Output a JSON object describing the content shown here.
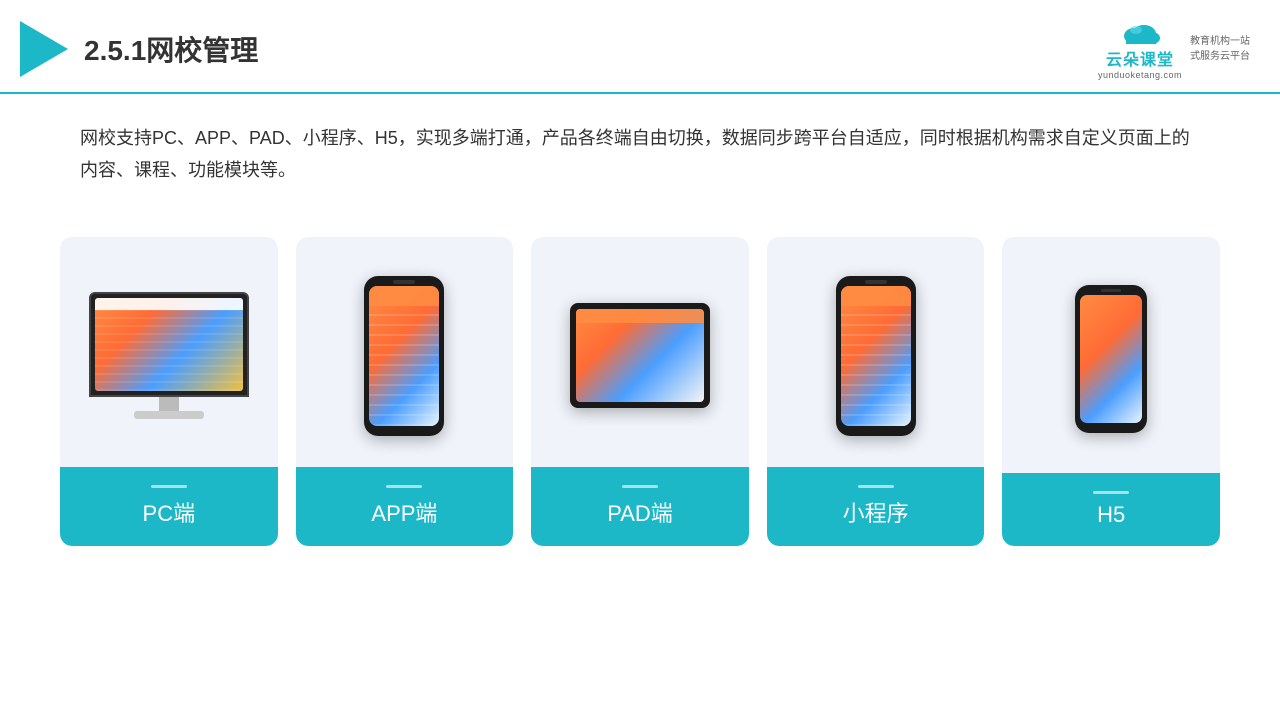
{
  "header": {
    "title": "2.5.1网校管理",
    "brand_name": "云朵课堂",
    "brand_url": "yunduoketang.com",
    "brand_slogan_line1": "教育机构一站",
    "brand_slogan_line2": "式服务云平台"
  },
  "description": {
    "text": "网校支持PC、APP、PAD、小程序、H5，实现多端打通，产品各终端自由切换，数据同步跨平台自适应，同时根据机构需求自定义页面上的内容、课程、功能模块等。"
  },
  "cards": [
    {
      "id": "pc",
      "label": "PC端"
    },
    {
      "id": "app",
      "label": "APP端"
    },
    {
      "id": "pad",
      "label": "PAD端"
    },
    {
      "id": "miniprogram",
      "label": "小程序"
    },
    {
      "id": "h5",
      "label": "H5"
    }
  ]
}
